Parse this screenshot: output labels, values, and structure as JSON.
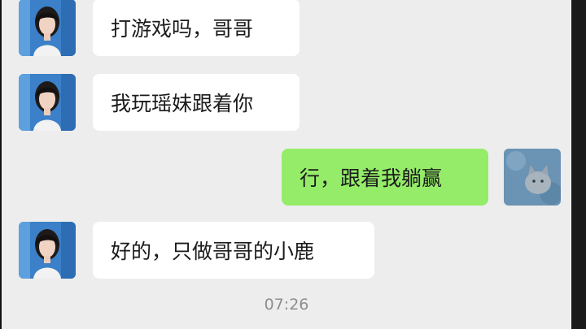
{
  "conversation": {
    "messages": [
      {
        "sender": "contact",
        "text": "打游戏吗，哥哥",
        "avatar": "girl-portrait"
      },
      {
        "sender": "contact",
        "text": "我玩瑶妹跟着你",
        "avatar": "girl-portrait"
      },
      {
        "sender": "self",
        "text": "行，跟着我躺赢",
        "avatar": "cat-portrait"
      },
      {
        "sender": "contact",
        "text": "好的，只做哥哥的小鹿",
        "avatar": "girl-portrait"
      }
    ],
    "timestamp": "07:26"
  },
  "colors": {
    "chat_background": "#ededed",
    "incoming_bubble": "#ffffff",
    "outgoing_bubble": "#95ec69",
    "timestamp_text": "#8e8e8e"
  }
}
